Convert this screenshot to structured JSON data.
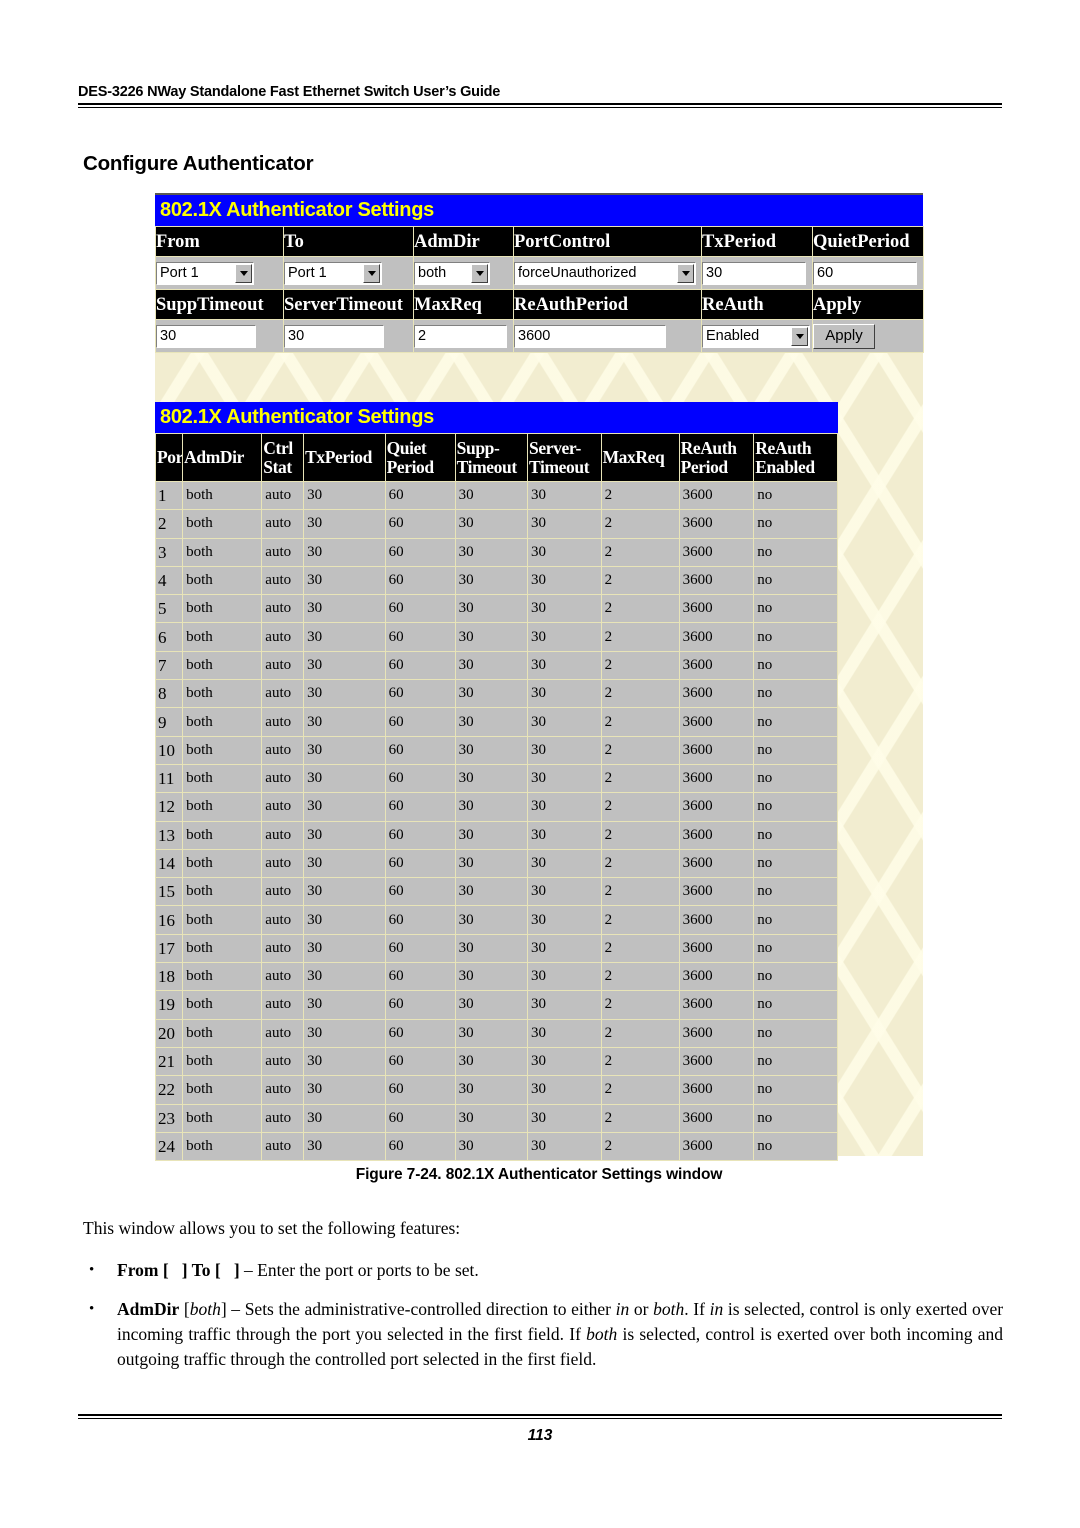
{
  "document": {
    "header": "DES-3226 NWay Standalone Fast Ethernet Switch User’s Guide",
    "section_title": "Configure Authenticator",
    "figure_caption": "Figure 7-24.  802.1X Authenticator Settings window",
    "page_number": "113"
  },
  "settings_window": {
    "title": "802.1X Authenticator Settings",
    "row1_headers": [
      "From",
      "To",
      "AdmDir",
      "PortControl",
      "TxPeriod",
      "QuietPeriod"
    ],
    "row1_fields": [
      {
        "type": "select",
        "value": "Port 1"
      },
      {
        "type": "select",
        "value": "Port 1"
      },
      {
        "type": "select",
        "value": "both"
      },
      {
        "type": "select",
        "value": "forceUnauthorized"
      },
      {
        "type": "input",
        "value": "30"
      },
      {
        "type": "input",
        "value": "60"
      }
    ],
    "row2_headers": [
      "SuppTimeout",
      "ServerTimeout",
      "MaxReq",
      "ReAuthPeriod",
      "ReAuth",
      "Apply"
    ],
    "row2_fields": [
      {
        "type": "input",
        "value": "30"
      },
      {
        "type": "input",
        "value": "30"
      },
      {
        "type": "input",
        "value": "2"
      },
      {
        "type": "input",
        "value": "3600"
      },
      {
        "type": "select",
        "value": "Enabled"
      },
      {
        "type": "button",
        "value": "Apply"
      }
    ]
  },
  "status_table": {
    "title": "802.1X Authenticator Settings",
    "columns": [
      "Port",
      "AdmDir",
      "Ctrl Stat",
      "TxPeriod",
      "Quiet Period",
      "Supp- Timeout",
      "Server- Timeout",
      "MaxReq",
      "ReAuth Period",
      "ReAuth Enabled"
    ],
    "columns_multiline": [
      [
        "Port"
      ],
      [
        "AdmDir"
      ],
      [
        "Ctrl",
        "Stat"
      ],
      [
        "TxPeriod"
      ],
      [
        "Quiet",
        "Period"
      ],
      [
        "Supp-",
        "Timeout"
      ],
      [
        "Server-",
        "Timeout"
      ],
      [
        "MaxReq"
      ],
      [
        "ReAuth",
        "Period"
      ],
      [
        "ReAuth",
        "Enabled"
      ]
    ],
    "rows": [
      [
        "1",
        "both",
        "auto",
        "30",
        "60",
        "30",
        "30",
        "2",
        "3600",
        "no"
      ],
      [
        "2",
        "both",
        "auto",
        "30",
        "60",
        "30",
        "30",
        "2",
        "3600",
        "no"
      ],
      [
        "3",
        "both",
        "auto",
        "30",
        "60",
        "30",
        "30",
        "2",
        "3600",
        "no"
      ],
      [
        "4",
        "both",
        "auto",
        "30",
        "60",
        "30",
        "30",
        "2",
        "3600",
        "no"
      ],
      [
        "5",
        "both",
        "auto",
        "30",
        "60",
        "30",
        "30",
        "2",
        "3600",
        "no"
      ],
      [
        "6",
        "both",
        "auto",
        "30",
        "60",
        "30",
        "30",
        "2",
        "3600",
        "no"
      ],
      [
        "7",
        "both",
        "auto",
        "30",
        "60",
        "30",
        "30",
        "2",
        "3600",
        "no"
      ],
      [
        "8",
        "both",
        "auto",
        "30",
        "60",
        "30",
        "30",
        "2",
        "3600",
        "no"
      ],
      [
        "9",
        "both",
        "auto",
        "30",
        "60",
        "30",
        "30",
        "2",
        "3600",
        "no"
      ],
      [
        "10",
        "both",
        "auto",
        "30",
        "60",
        "30",
        "30",
        "2",
        "3600",
        "no"
      ],
      [
        "11",
        "both",
        "auto",
        "30",
        "60",
        "30",
        "30",
        "2",
        "3600",
        "no"
      ],
      [
        "12",
        "both",
        "auto",
        "30",
        "60",
        "30",
        "30",
        "2",
        "3600",
        "no"
      ],
      [
        "13",
        "both",
        "auto",
        "30",
        "60",
        "30",
        "30",
        "2",
        "3600",
        "no"
      ],
      [
        "14",
        "both",
        "auto",
        "30",
        "60",
        "30",
        "30",
        "2",
        "3600",
        "no"
      ],
      [
        "15",
        "both",
        "auto",
        "30",
        "60",
        "30",
        "30",
        "2",
        "3600",
        "no"
      ],
      [
        "16",
        "both",
        "auto",
        "30",
        "60",
        "30",
        "30",
        "2",
        "3600",
        "no"
      ],
      [
        "17",
        "both",
        "auto",
        "30",
        "60",
        "30",
        "30",
        "2",
        "3600",
        "no"
      ],
      [
        "18",
        "both",
        "auto",
        "30",
        "60",
        "30",
        "30",
        "2",
        "3600",
        "no"
      ],
      [
        "19",
        "both",
        "auto",
        "30",
        "60",
        "30",
        "30",
        "2",
        "3600",
        "no"
      ],
      [
        "20",
        "both",
        "auto",
        "30",
        "60",
        "30",
        "30",
        "2",
        "3600",
        "no"
      ],
      [
        "21",
        "both",
        "auto",
        "30",
        "60",
        "30",
        "30",
        "2",
        "3600",
        "no"
      ],
      [
        "22",
        "both",
        "auto",
        "30",
        "60",
        "30",
        "30",
        "2",
        "3600",
        "no"
      ],
      [
        "23",
        "both",
        "auto",
        "30",
        "60",
        "30",
        "30",
        "2",
        "3600",
        "no"
      ],
      [
        "24",
        "both",
        "auto",
        "30",
        "60",
        "30",
        "30",
        "2",
        "3600",
        "no"
      ]
    ]
  },
  "body": {
    "intro": "This window allows you to set the following features:",
    "bullet_marker": "•",
    "bullets": [
      {
        "id": "from-to",
        "html": "<b>From [&nbsp;&nbsp;&nbsp;] To [&nbsp;&nbsp;&nbsp;]</b> – Enter the port or ports to be set."
      },
      {
        "id": "admdir",
        "html": "<b>AdmDir</b> [<i>both</i>] – Sets the administrative-controlled direction to either <i>in</i> or <i>both</i>. If <i>in</i> is selected, control is only exerted over incoming traffic through the port you selected in the first field. If <i>both</i> is selected, control is exerted over both incoming and outgoing traffic through the controlled port selected in the first field."
      }
    ]
  },
  "colors": {
    "title_bar_bg": "#0000FF",
    "title_bar_text": "#FFFF00",
    "table_header_bg": "#000000",
    "table_header_text": "#FFFFFF",
    "cell_bg": "#C0C0C0",
    "grid_line": "#E8E4B8",
    "page_bg": "#F2EDD0"
  }
}
